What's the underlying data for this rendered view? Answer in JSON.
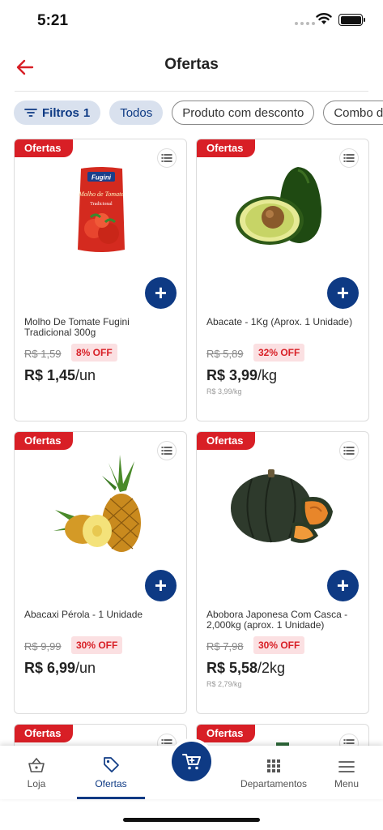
{
  "status": {
    "time": "5:21"
  },
  "header": {
    "title": "Ofertas"
  },
  "chips": {
    "filters_label": "Filtros",
    "filters_count": "1",
    "all": "Todos",
    "discount": "Produto com desconto",
    "combo": "Combo de"
  },
  "products": [
    {
      "tag": "Ofertas",
      "name": "Molho De Tomate Fugini Tradicional 300g",
      "old_price": "R$ 1,59",
      "discount": "8% OFF",
      "price": "R$ 1,45",
      "unit": "/un",
      "unit_price": ""
    },
    {
      "tag": "Ofertas",
      "name": "Abacate - 1Kg (Aprox. 1 Unidade)",
      "old_price": "R$ 5,89",
      "discount": "32% OFF",
      "price": "R$ 3,99",
      "unit": "/kg",
      "unit_price": "R$ 3,99/kg"
    },
    {
      "tag": "Ofertas",
      "name": "Abacaxi Pérola - 1 Unidade",
      "old_price": "R$ 9,99",
      "discount": "30% OFF",
      "price": "R$ 6,99",
      "unit": "/un",
      "unit_price": ""
    },
    {
      "tag": "Ofertas",
      "name": "Abobora Japonesa Com Casca - 2,000kg (aprox. 1 Unidade)",
      "old_price": "R$ 7,98",
      "discount": "30% OFF",
      "price": "R$ 5,58",
      "unit": "/2kg",
      "unit_price": "R$ 2,79/kg"
    },
    {
      "tag": "Ofertas"
    },
    {
      "tag": "Ofertas"
    }
  ],
  "package_text": {
    "brand": "Fugini",
    "product": "Molho de Tomate",
    "variant": "Tradicional"
  },
  "tabbar": {
    "store": "Loja",
    "offers": "Ofertas",
    "departments": "Departamentos",
    "menu": "Menu"
  },
  "colors": {
    "brand_blue": "#0e3a84",
    "offer_red": "#d81f26"
  }
}
